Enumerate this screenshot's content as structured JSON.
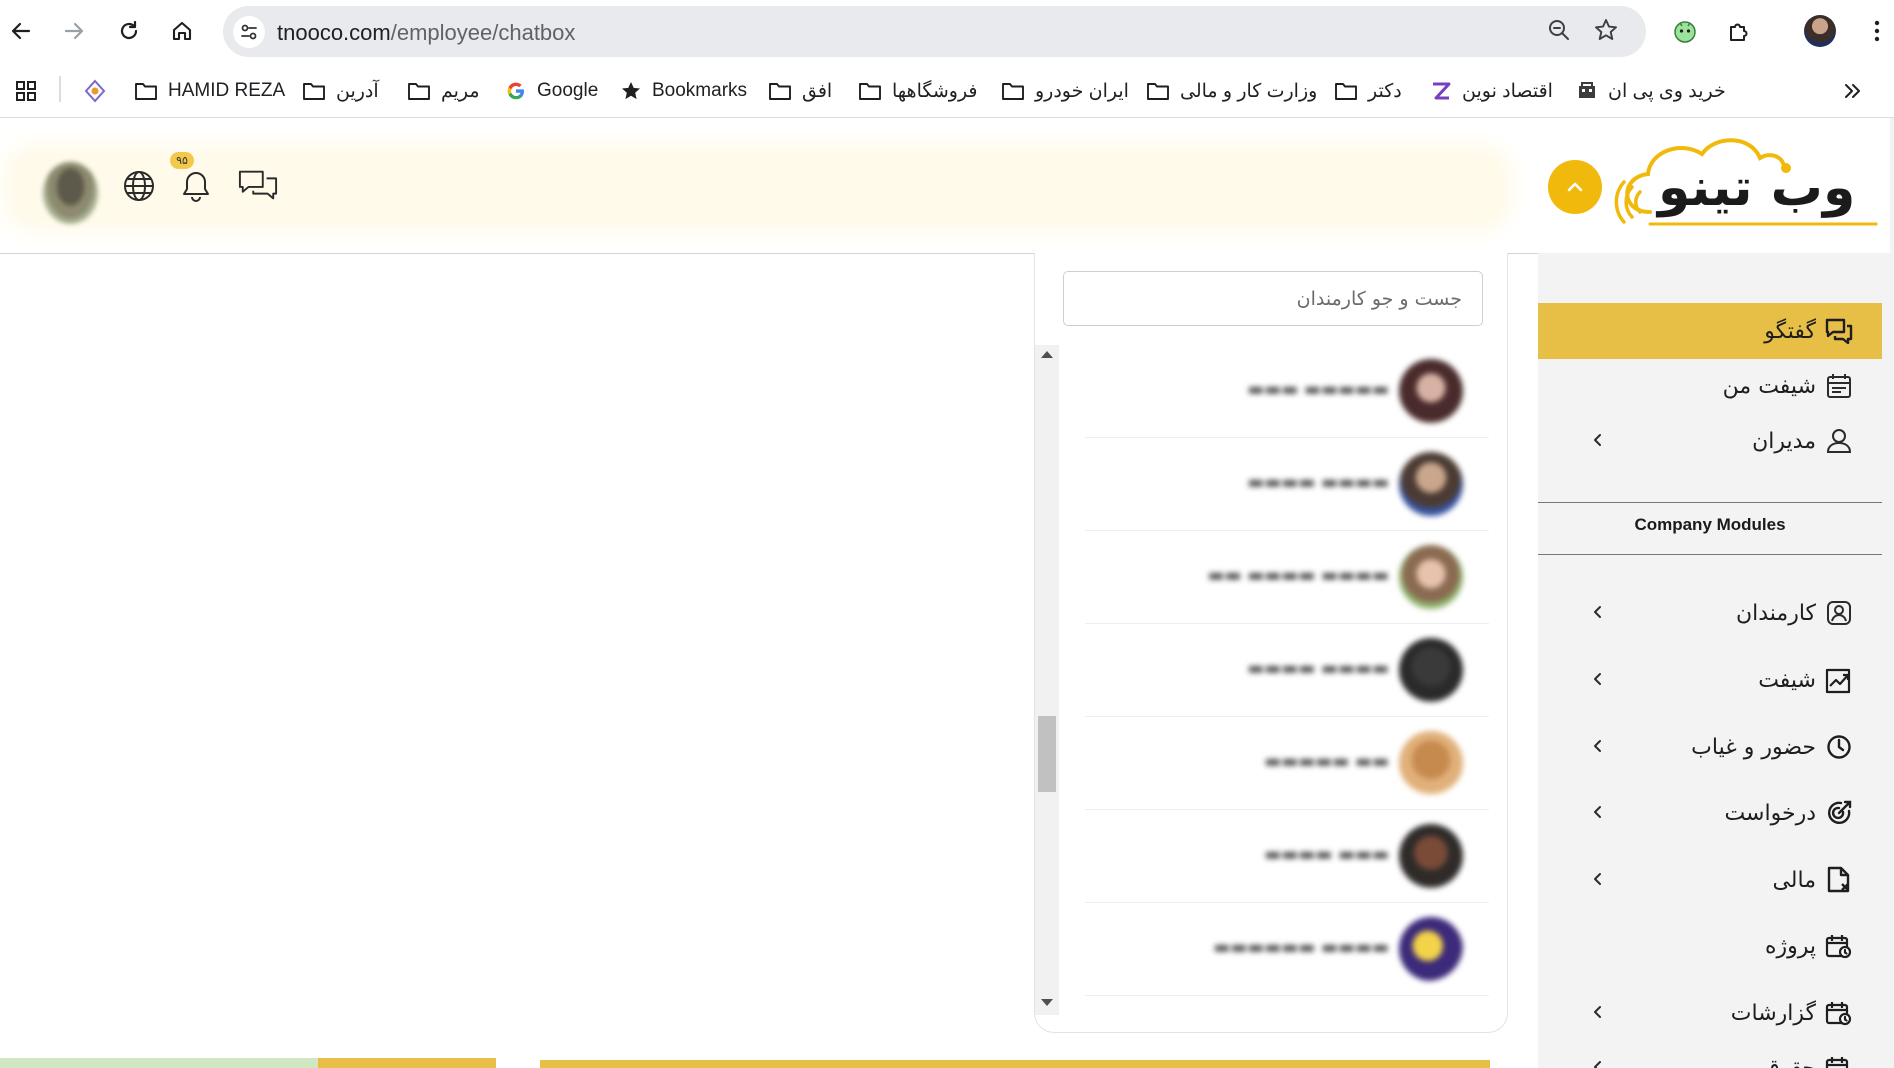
{
  "browser": {
    "url_host": "tnooco.com",
    "url_path": "/employee/chatbox",
    "bookmarks": [
      {
        "label": "HAMID REZA",
        "icon": "folder-icon"
      },
      {
        "label": "آدرین",
        "icon": "folder-icon"
      },
      {
        "label": "مریم",
        "icon": "folder-icon"
      },
      {
        "label": "Google",
        "icon": "google-icon"
      },
      {
        "label": "Bookmarks",
        "icon": "star-icon"
      },
      {
        "label": "افق",
        "icon": "folder-icon"
      },
      {
        "label": "فروشگاهها",
        "icon": "folder-icon"
      },
      {
        "label": "ایران خودرو",
        "icon": "folder-icon"
      },
      {
        "label": "وزارت کار و مالی",
        "icon": "folder-icon"
      },
      {
        "label": "دکتر",
        "icon": "folder-icon"
      },
      {
        "label": "اقتصاد نوین",
        "icon": "site-icon"
      },
      {
        "label": "خرید وی پی ان",
        "icon": "site-icon"
      }
    ]
  },
  "header": {
    "notification_count": "۹۵"
  },
  "brand": {
    "logo_text": "وب تینو",
    "accent_color": "#e8bf46"
  },
  "sidebar": {
    "items_top": [
      {
        "label": "گفتگو",
        "icon": "chat-icon",
        "active": true,
        "has_chevron": false
      },
      {
        "label": "شیفت من",
        "icon": "calendar-icon",
        "active": false,
        "has_chevron": false
      },
      {
        "label": "مدیران",
        "icon": "managers-icon",
        "active": false,
        "has_chevron": true
      }
    ],
    "section_title": "Company Modules",
    "items_modules": [
      {
        "label": "کارمندان",
        "icon": "employee-icon",
        "has_chevron": true
      },
      {
        "label": "شیفت",
        "icon": "shift-chart-icon",
        "has_chevron": true
      },
      {
        "label": "حضور و غیاب",
        "icon": "clock-icon",
        "has_chevron": true
      },
      {
        "label": "درخواست",
        "icon": "target-icon",
        "has_chevron": true
      },
      {
        "label": "مالی",
        "icon": "document-icon",
        "has_chevron": true
      },
      {
        "label": "پروژه",
        "icon": "project-icon",
        "has_chevron": false
      },
      {
        "label": "گزارشات",
        "icon": "report-icon",
        "has_chevron": true
      },
      {
        "label": "حقوق",
        "icon": "salary-icon",
        "has_chevron": true
      }
    ]
  },
  "employees": {
    "search_placeholder": "جست و جو کارمندان"
  }
}
